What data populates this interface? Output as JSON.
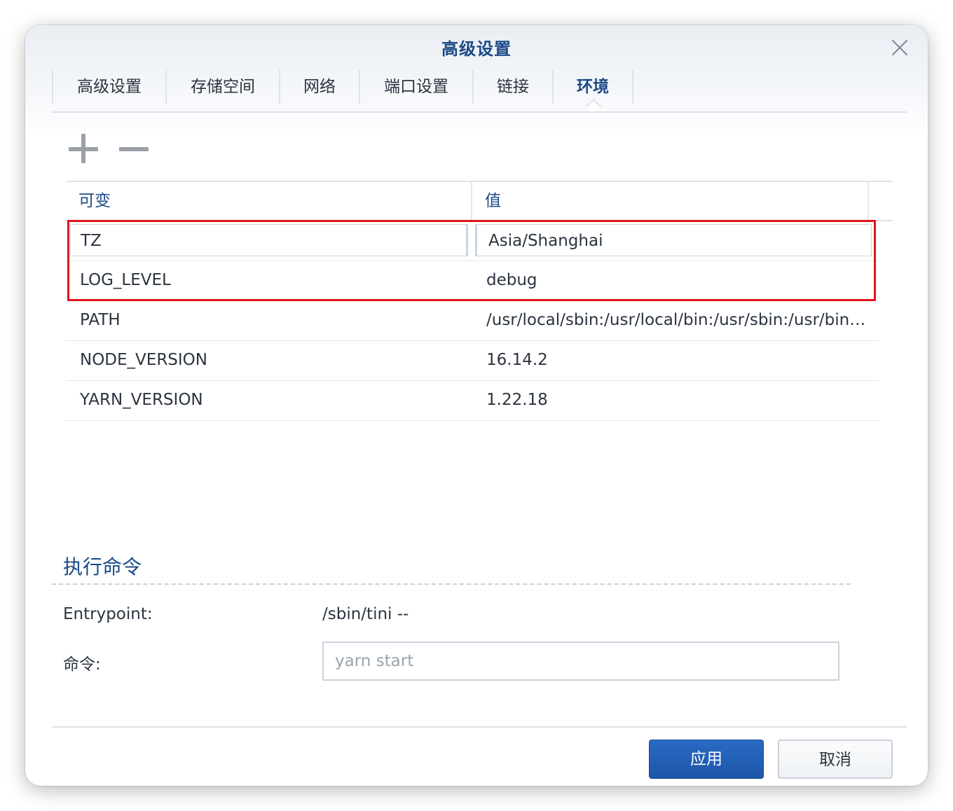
{
  "dialog": {
    "title": "高级设置",
    "close_icon": "close-icon"
  },
  "tabs": [
    {
      "label": "高级设置",
      "active": false
    },
    {
      "label": "存储空间",
      "active": false
    },
    {
      "label": "网络",
      "active": false
    },
    {
      "label": "端口设置",
      "active": false
    },
    {
      "label": "链接",
      "active": false
    },
    {
      "label": "环境",
      "active": true
    }
  ],
  "toolbar": {
    "add_icon": "plus-icon",
    "remove_icon": "minus-icon"
  },
  "env_table": {
    "columns": [
      "可变",
      "值"
    ],
    "rows": [
      {
        "variable": "TZ",
        "value": "Asia/Shanghai"
      },
      {
        "variable": "LOG_LEVEL",
        "value": "debug"
      },
      {
        "variable": "PATH",
        "value": "/usr/local/sbin:/usr/local/bin:/usr/sbin:/usr/bin:/sbin:/bin"
      },
      {
        "variable": "NODE_VERSION",
        "value": "16.14.2"
      },
      {
        "variable": "YARN_VERSION",
        "value": "1.22.18"
      }
    ],
    "highlight_color": "#e0161c"
  },
  "exec": {
    "section_title": "执行命令",
    "entrypoint_label": "Entrypoint:",
    "entrypoint_value": "/sbin/tini --",
    "command_label": "命令:",
    "command_placeholder": "yarn start",
    "command_value": ""
  },
  "footer": {
    "apply_label": "应用",
    "cancel_label": "取消"
  },
  "colors": {
    "accent": "#1c4a86",
    "primary_button": "#2364ba"
  }
}
